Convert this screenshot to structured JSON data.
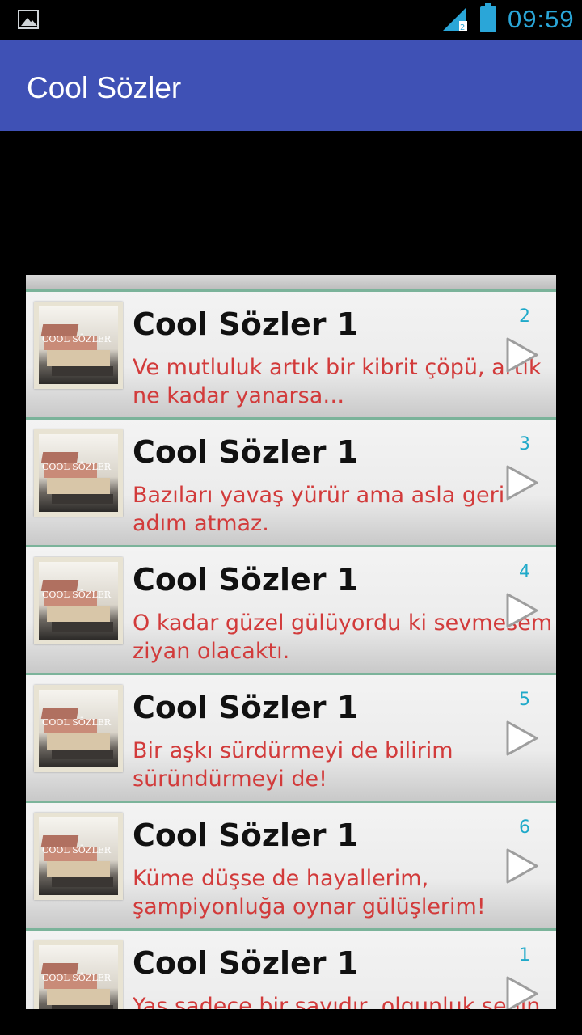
{
  "status_bar": {
    "time": "09:59",
    "icons": [
      "image-icon",
      "signal-icon",
      "battery-icon"
    ]
  },
  "app_bar": {
    "title": "Cool Sözler"
  },
  "list": {
    "items": [
      {
        "title": "Cool Sözler 1",
        "quote": "Ve mutluluk artık bir kibrit çöpü, artık ne kadar yanarsa…",
        "number": "2",
        "thumb_text": "COOL SÖZLER"
      },
      {
        "title": "Cool Sözler 1",
        "quote": "Bazıları yavaş yürür ama asla geri adım atmaz.",
        "number": "3",
        "thumb_text": "COOL SÖZLER"
      },
      {
        "title": "Cool Sözler 1",
        "quote": "O kadar güzel gülüyordu ki sevmesem ziyan olacaktı.",
        "number": "4",
        "thumb_text": "COOL SÖZLER"
      },
      {
        "title": "Cool Sözler 1",
        "quote": "Bir aşkı sürdürmeyi de bilirim süründürmeyi de!",
        "number": "5",
        "thumb_text": "COOL SÖZLER"
      },
      {
        "title": "Cool Sözler 1",
        "quote": "Küme düşse de hayallerim, şampiyonluğa oynar gülüşlerim!",
        "number": "6",
        "thumb_text": "COOL SÖZLER"
      },
      {
        "title": "Cool Sözler 1",
        "quote": "Yaş sadece bir sayıdır, olgunluk senin",
        "number": "1",
        "thumb_text": "COOL SÖZLER"
      }
    ]
  },
  "colors": {
    "app_bar": "#3f51b5",
    "quote_text": "#d23b3b",
    "number_text": "#1fa9c9",
    "divider": "#7bb39a",
    "status_accent": "#2aa6d8"
  }
}
